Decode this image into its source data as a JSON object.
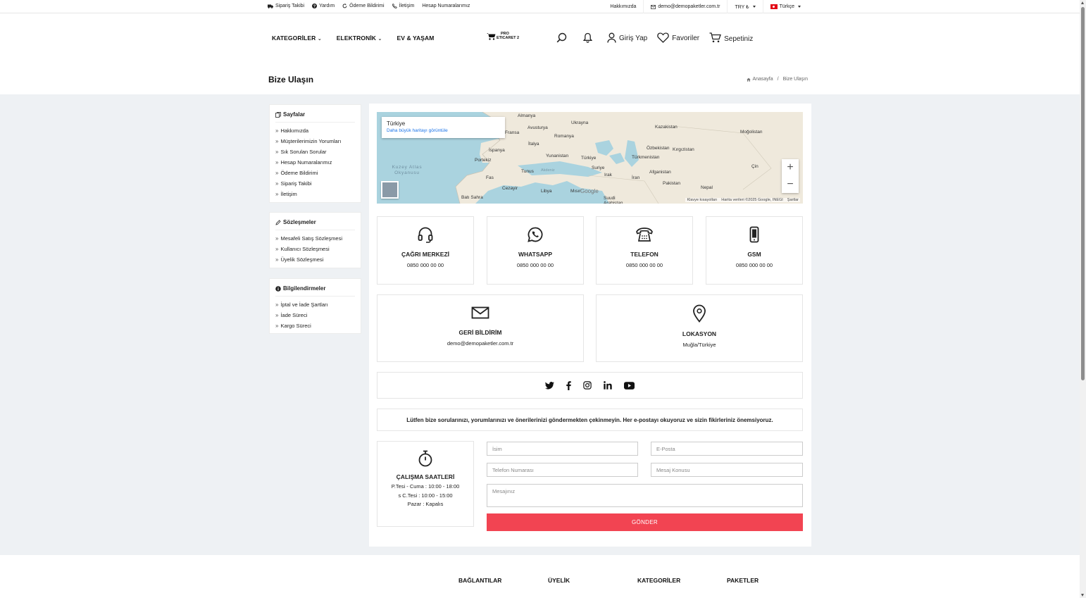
{
  "topbar": {
    "left_links": [
      {
        "label": "Sipariş Takibi",
        "icon": "truck-icon"
      },
      {
        "label": "Yardım",
        "icon": "question-circle-icon"
      },
      {
        "label": "Ödeme Bildirimi",
        "icon": "refresh-icon"
      },
      {
        "label": "İletişim",
        "icon": "phone-icon"
      },
      {
        "label": "Hesap Numaralarımız",
        "icon": ""
      }
    ],
    "about": "Hakkımızda",
    "email": "demo@demopaketler.com.tr",
    "currency": "TRY ₺",
    "language": "Türkçe"
  },
  "header": {
    "nav": [
      "KATEGORİLER",
      "ELEKTRONİK",
      "EV & YAŞAM"
    ],
    "logo_line1": "PRO",
    "logo_line2": "ETICARET 2",
    "login": "Giriş Yap",
    "favorites": "Favoriler",
    "cart": "Sepetiniz"
  },
  "page": {
    "title": "Bize Ulaşın",
    "breadcrumb_home": "Anasayfa",
    "breadcrumb_sep": "/",
    "breadcrumb_current": "Bize Ulaşın"
  },
  "sidebar": {
    "pages_title": "Sayfalar",
    "pages": [
      "Hakkımızda",
      "Müşterilerimizin Yorumları",
      "Sık Sorulan Sorular",
      "Hesap Numaralarımız",
      "Ödeme Bildirimi",
      "Sipariş Takibi",
      "İletişim"
    ],
    "contracts_title": "Sözleşmeler",
    "contracts": [
      "Mesafeli Satış Sözleşmesi",
      "Kullanıcı Sözleşmesi",
      "Üyelik Sözleşmesi"
    ],
    "info_title": "Bilgilendirmeler",
    "info": [
      "İptal ve İade Şartları",
      "İade Süreci",
      "Kargo Süreci"
    ]
  },
  "map": {
    "place": "Türkiye",
    "larger_link": "Daha büyük haritayı görüntüle",
    "labels": [
      "Almanya",
      "Ukrayna",
      "Kazakistan",
      "Moğolistan",
      "Fransa",
      "Avusturya",
      "Romanya",
      "İtalya",
      "İspanya",
      "Portekiz",
      "Özbekistan",
      "Kırgızistan",
      "Yunanistan",
      "Türkiye",
      "Türkmenistan",
      "Çin",
      "Kuzey Atlas Okyanusu",
      "Tunus",
      "Akdeniz",
      "Suriye",
      "Afganistan",
      "Irak",
      "İran",
      "Pakistan",
      "Fas",
      "Cezayir",
      "Libya",
      "Mısır",
      "Nepal",
      "Batı Sahra",
      "Suudi Arabistan"
    ],
    "footer": [
      "Klavye kısayolları",
      "Harita verileri ©2025 Google, INEGI",
      "Şartlar"
    ],
    "google": "Google",
    "zoom_in": "+",
    "zoom_out": "−"
  },
  "contacts": [
    {
      "title": "ÇAĞRI MERKEZİ",
      "value": "0850 000 00 00",
      "icon": "headset-icon"
    },
    {
      "title": "WHATSAPP",
      "value": "0850 000 00 00",
      "icon": "whatsapp-icon"
    },
    {
      "title": "TELEFON",
      "value": "0850 000 00 00",
      "icon": "telephone-icon"
    },
    {
      "title": "GSM",
      "value": "0850 000 00 00",
      "icon": "mobile-phone-icon"
    },
    {
      "title": "GERİ BİLDİRİM",
      "value": "demo@demopaketler.com.tr",
      "icon": "envelope-icon"
    },
    {
      "title": "LOKASYON",
      "value": "Muğla/Türkiye",
      "icon": "map-pin-icon"
    }
  ],
  "social": [
    "twitter-icon",
    "facebook-icon",
    "instagram-icon",
    "linkedin-icon",
    "youtube-icon"
  ],
  "notice": "Lütfen bize sorularınızı, yorumlarınızı ve önerilerinizi göndermekten çekinmeyin. Her e-postayı okuyoruz ve sizin fikirleriniz önemsiyoruz.",
  "hours": {
    "title": "ÇALIŞMA SAATLERİ",
    "line1": "P.Tesi - Cuma : 10:00 - 18:00",
    "line2": "s C.Tesi : 10:00 - 15:00",
    "line3": "Pazar : Kapalıs"
  },
  "form": {
    "name_placeholder": "İsim",
    "email_placeholder": "E-Posta",
    "phone_placeholder": "Telefon Numarası",
    "subject_placeholder": "Mesaj Konusu",
    "message_placeholder": "Mesajınız",
    "submit": "GÖNDER"
  },
  "footer": {
    "columns": [
      "BAĞLANTILAR",
      "ÜYELİK",
      "KATEGORİLER",
      "PAKETLER"
    ]
  },
  "colors": {
    "accent": "#f24452",
    "background": "#eef1f4"
  }
}
